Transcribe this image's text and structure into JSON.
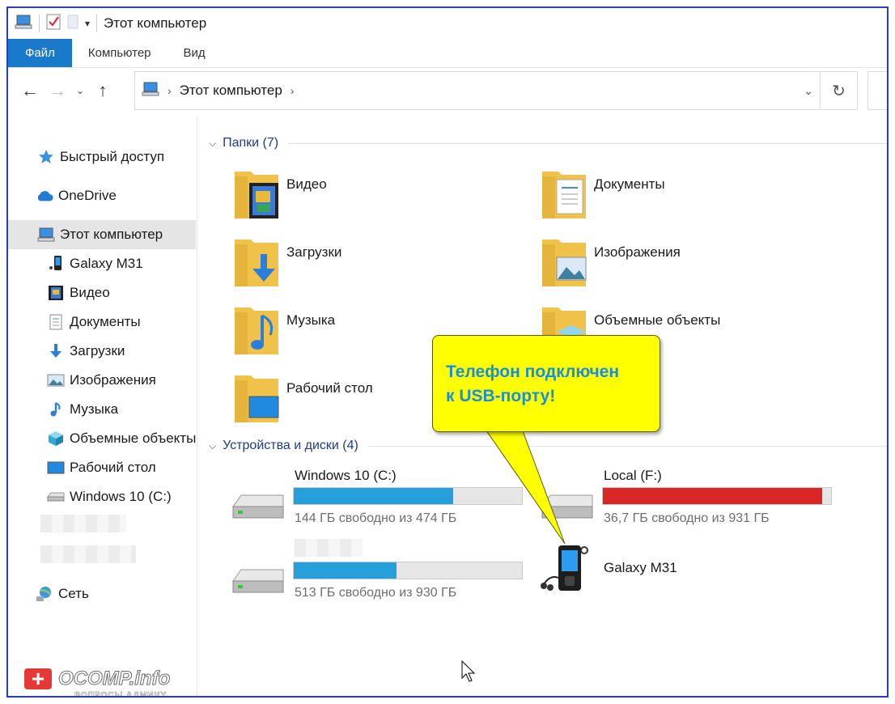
{
  "window": {
    "title": "Этот компьютер"
  },
  "ribbon": {
    "tabs": [
      "Файл",
      "Компьютер",
      "Вид"
    ]
  },
  "address": {
    "path": "Этот компьютер"
  },
  "sidebar": {
    "items": [
      {
        "label": "Быстрый доступ",
        "icon": "star-icon"
      },
      {
        "label": "OneDrive",
        "icon": "cloud-icon"
      },
      {
        "label": "Этот компьютер",
        "icon": "computer-icon"
      },
      {
        "label": "Galaxy M31",
        "icon": "phone-icon"
      },
      {
        "label": "Видео",
        "icon": "video-icon"
      },
      {
        "label": "Документы",
        "icon": "document-icon"
      },
      {
        "label": "Загрузки",
        "icon": "download-icon"
      },
      {
        "label": "Изображения",
        "icon": "image-icon"
      },
      {
        "label": "Музыка",
        "icon": "music-icon"
      },
      {
        "label": "Объемные объекты",
        "icon": "cube-icon"
      },
      {
        "label": "Рабочий стол",
        "icon": "desktop-icon"
      },
      {
        "label": "Windows 10 (C:)",
        "icon": "drive-icon"
      },
      {
        "label": "Сеть",
        "icon": "network-icon"
      }
    ]
  },
  "folders_group": {
    "title": "Папки (7)",
    "items": [
      {
        "label": "Видео",
        "icon": "video-folder-icon"
      },
      {
        "label": "Документы",
        "icon": "documents-folder-icon"
      },
      {
        "label": "Загрузки",
        "icon": "downloads-folder-icon"
      },
      {
        "label": "Изображения",
        "icon": "pictures-folder-icon"
      },
      {
        "label": "Музыка",
        "icon": "music-folder-icon"
      },
      {
        "label": "Объемные объекты",
        "icon": "3d-objects-folder-icon"
      },
      {
        "label": "Рабочий стол",
        "icon": "desktop-folder-icon"
      }
    ]
  },
  "devices_group": {
    "title": "Устройства и диски (4)",
    "drives": [
      {
        "label": "Windows 10 (C:)",
        "free_text": "144 ГБ свободно из 474 ГБ",
        "used_fraction": 0.7,
        "color": "#26a0da"
      },
      {
        "label": "Local (F:)",
        "free_text": "36,7 ГБ свободно из 931 ГБ",
        "used_fraction": 0.96,
        "color": "#da2626"
      },
      {
        "label": "",
        "free_text": "513 ГБ свободно из 930 ГБ",
        "used_fraction": 0.45,
        "color": "#26a0da"
      }
    ],
    "device": {
      "label": "Galaxy M31",
      "icon": "media-player-icon"
    }
  },
  "callout": {
    "line1": "Телефон подключен",
    "line2": "к USB-порту!"
  },
  "watermark": {
    "brand": "OCOMP.info",
    "tagline": "ВОПРОСЫ АДМИНУ"
  },
  "colors": {
    "accent": "#1979ca",
    "frame": "#2a3cb6",
    "callout_bg": "#ffff00",
    "callout_text": "#1b8fd6"
  }
}
